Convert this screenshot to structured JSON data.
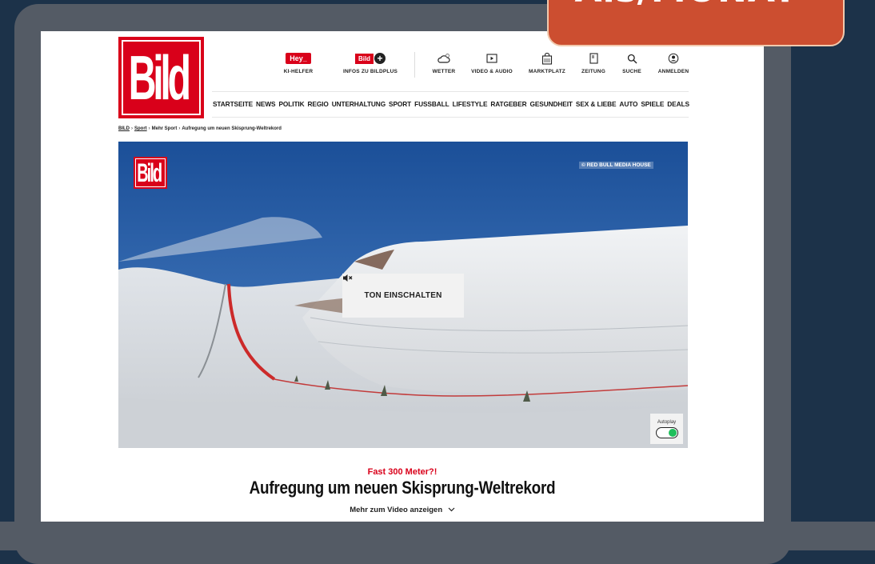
{
  "promo": {
    "text": "Als/MONAT*"
  },
  "logo": {
    "text": "Bild"
  },
  "util_nav": [
    {
      "label": "KI-HELFER",
      "icon": "hey-badge",
      "badge": "Hey_"
    },
    {
      "label": "INFOS ZU BILDPLUS",
      "icon": "bildplus-badge",
      "badge": "Bild"
    },
    {
      "label": "WETTER",
      "icon": "weather-icon"
    },
    {
      "label": "VIDEO & AUDIO",
      "icon": "video-icon"
    },
    {
      "label": "MARKTPLATZ",
      "icon": "marketplace-icon"
    },
    {
      "label": "ZEITUNG",
      "icon": "newspaper-icon"
    },
    {
      "label": "SUCHE",
      "icon": "search-icon"
    },
    {
      "label": "ANMELDEN",
      "icon": "user-icon"
    }
  ],
  "main_nav": [
    "STARTSEITE",
    "NEWS",
    "POLITIK",
    "REGIO",
    "UNTERHALTUNG",
    "SPORT",
    "FUSSBALL",
    "LIFESTYLE",
    "RATGEBER",
    "GESUNDHEIT",
    "SEX & LIEBE",
    "AUTO",
    "SPIELE",
    "DEALS"
  ],
  "breadcrumb": [
    "BILD",
    "Sport",
    "Mehr Sport",
    "Aufregung um neuen Skisprung-Weltrekord"
  ],
  "video": {
    "logo": "Bild",
    "credit": "© RED BULL MEDIA HOUSE",
    "sound_button": "TON EINSCHALTEN",
    "autoplay_label": "Autoplay",
    "autoplay_on": true
  },
  "article": {
    "kicker": "Fast 300 Meter?!",
    "headline": "Aufregung um neuen Skisprung-Weltrekord",
    "more_link": "Mehr zum Video anzeigen"
  },
  "colors": {
    "brand_red": "#d9001a",
    "promo": "#cc4e30",
    "background": "#1c3249"
  }
}
